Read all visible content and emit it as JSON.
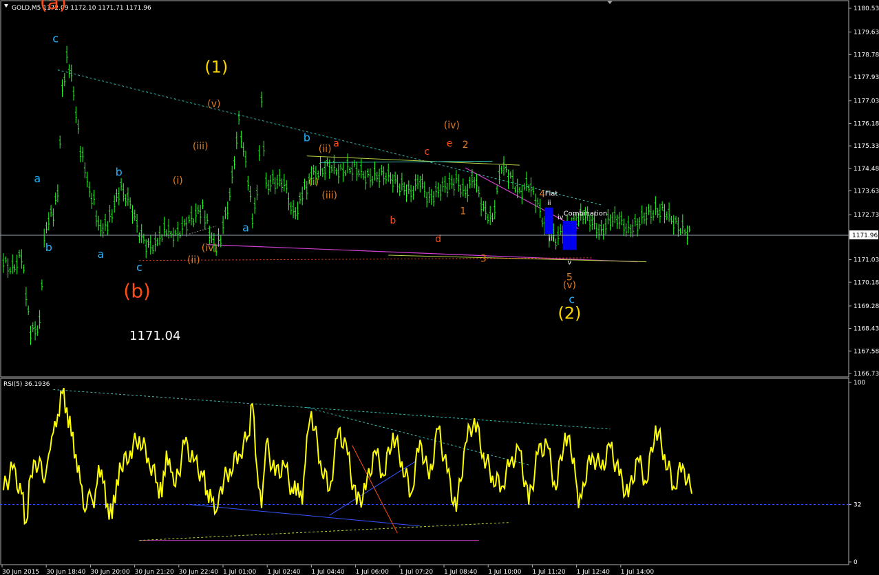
{
  "window": {
    "main_header": "GOLD,M5  1172.09 1172.10 1171.71 1171.96",
    "rsi_header": "RSI(5) 36.1936",
    "current_price_label": "1171.96",
    "big_price_text": "1171.04"
  },
  "colors": {
    "background": "#000000",
    "bull_candle": "#22ff22",
    "rsi_line": "#ffff00",
    "wave_blue": "#1fb2ff",
    "wave_orange": "#e07b20",
    "wave_red": "#ff4d1a",
    "wave_yellow": "#ffd700",
    "trend_magenta": "#d040d0",
    "trend_cyan_dashed": "#33c0b0",
    "trend_lime": "#b8d040",
    "correction_box": "#0000ee"
  },
  "chart_data": [
    {
      "type": "line",
      "title": "GOLD,M5",
      "ylabel": "",
      "xlabel": "",
      "ylim": [
        1166.73,
        1180.53
      ],
      "y_ticks": [
        "1180.53",
        "1179.63",
        "1178.78",
        "1177.93",
        "1177.03",
        "1176.18",
        "1175.33",
        "1174.48",
        "1173.63",
        "1172.73",
        "1171.96",
        "1171.03",
        "1170.18",
        "1169.28",
        "1168.43",
        "1167.58",
        "1166.73"
      ],
      "x_ticks": [
        "30 Jun 2015",
        "30 Jun 18:40",
        "30 Jun 20:00",
        "30 Jun 21:20",
        "30 Jun 22:40",
        "1 Jul 01:00",
        "1 Jul 02:40",
        "1 Jul 04:40",
        "1 Jul 06:00",
        "1 Jul 07:20",
        "1 Jul 08:40",
        "1 Jul 10:00",
        "1 Jul 11:20",
        "1 Jul 12:40",
        "1 Jul 14:00"
      ],
      "x_range": [
        0,
        152
      ],
      "series": [
        {
          "x": [
            0,
            2,
            4,
            5,
            6,
            8,
            9,
            10,
            11,
            12,
            13,
            14,
            15,
            16,
            17,
            18,
            19,
            20,
            21,
            22,
            23,
            24,
            25,
            26,
            28,
            30,
            32,
            34,
            35,
            36,
            37,
            38,
            40,
            42,
            44,
            45,
            46,
            47,
            48,
            50,
            52,
            54,
            55,
            56,
            57,
            58,
            60,
            62,
            64,
            65,
            66,
            67,
            68,
            70,
            72,
            74,
            76,
            78,
            80,
            82,
            84,
            86,
            88,
            90,
            92,
            94,
            96,
            98,
            100,
            102,
            104,
            106,
            108,
            110,
            112,
            114,
            116,
            118,
            120,
            122,
            124,
            126,
            127,
            128,
            130,
            132,
            134,
            136,
            138,
            140,
            142,
            144,
            146,
            148,
            150,
            152
          ],
          "y": [
            1170.9,
            1170.7,
            1171.2,
            1169.8,
            1168.2,
            1168.6,
            1171.8,
            1172.6,
            1172.8,
            1173.6,
            1177.4,
            1178.6,
            1178.0,
            1176.6,
            1175.2,
            1174.5,
            1173.6,
            1173.2,
            1172.3,
            1172.2,
            1172.4,
            1172.8,
            1173.4,
            1173.7,
            1173.2,
            1172.0,
            1171.5,
            1171.7,
            1172.0,
            1172.2,
            1172.0,
            1171.9,
            1172.4,
            1172.6,
            1173.0,
            1172.4,
            1171.8,
            1171.5,
            1171.9,
            1173.4,
            1176.3,
            1174.1,
            1172.6,
            1173.5,
            1176.9,
            1173.9,
            1174.0,
            1173.9,
            1172.8,
            1172.9,
            1173.6,
            1173.8,
            1174.2,
            1174.4,
            1174.6,
            1174.3,
            1174.5,
            1174.5,
            1174.1,
            1174.2,
            1174.3,
            1174.0,
            1173.8,
            1173.6,
            1174.0,
            1173.3,
            1173.7,
            1173.8,
            1174.0,
            1173.6,
            1174.1,
            1172.9,
            1172.6,
            1174.6,
            1174.1,
            1173.6,
            1173.9,
            1173.1,
            1172.1,
            1171.8,
            1172.2,
            1172.4,
            1172.6,
            1172.8,
            1172.4,
            1172.1,
            1172.6,
            1172.5,
            1172.2,
            1172.4,
            1172.7,
            1172.9,
            1172.9,
            1172.4,
            1172.2,
            1172.0
          ]
        }
      ]
    },
    {
      "type": "line",
      "title": "RSI(5) 36.1936",
      "ylabel": "",
      "xlabel": "",
      "ylim": [
        0,
        100
      ],
      "y_ticks": [
        "100",
        "32",
        "0"
      ],
      "series": [
        {
          "x": [
            0,
            2,
            4,
            5,
            6,
            8,
            9,
            10,
            11,
            12,
            13,
            14,
            15,
            16,
            17,
            18,
            19,
            20,
            21,
            22,
            23,
            24,
            25,
            26,
            28,
            30,
            32,
            34,
            35,
            36,
            37,
            38,
            40,
            42,
            44,
            45,
            46,
            47,
            48,
            50,
            52,
            54,
            55,
            56,
            57,
            58,
            60,
            62,
            64,
            65,
            66,
            67,
            68,
            70,
            72,
            74,
            76,
            78,
            80,
            82,
            84,
            86,
            88,
            90,
            92,
            94,
            96,
            98,
            100,
            102,
            104,
            106,
            108,
            110,
            112,
            114,
            116,
            118,
            120,
            122,
            124,
            126,
            127,
            128,
            130,
            132,
            134,
            136,
            138,
            140,
            142,
            144,
            146,
            148,
            150,
            152
          ],
          "y": [
            40,
            52,
            38,
            22,
            48,
            58,
            44,
            60,
            72,
            82,
            94,
            86,
            70,
            60,
            44,
            28,
            40,
            30,
            54,
            44,
            32,
            24,
            46,
            52,
            62,
            70,
            58,
            44,
            36,
            62,
            50,
            42,
            66,
            56,
            48,
            40,
            34,
            28,
            42,
            52,
            60,
            70,
            88,
            52,
            30,
            66,
            48,
            54,
            38,
            44,
            32,
            70,
            84,
            56,
            40,
            74,
            60,
            32,
            40,
            62,
            48,
            72,
            56,
            38,
            68,
            46,
            74,
            50,
            28,
            66,
            80,
            60,
            48,
            42,
            56,
            62,
            32,
            60,
            66,
            40,
            72,
            58,
            30,
            44,
            60,
            52,
            64,
            48,
            36,
            58,
            44,
            76,
            60,
            42,
            54,
            38
          ]
        }
      ],
      "reference_line": 32
    }
  ],
  "annotations": {
    "blue": [
      {
        "text": "c",
        "x": 11.5,
        "y": 1179.25
      },
      {
        "text": "a",
        "x": 7.5,
        "y": 1173.95
      },
      {
        "text": "b",
        "x": 10,
        "y": 1171.35
      },
      {
        "text": "b",
        "x": 25.5,
        "y": 1174.2
      },
      {
        "text": "a",
        "x": 21.5,
        "y": 1171.1
      },
      {
        "text": "c",
        "x": 30,
        "y": 1170.6
      },
      {
        "text": "a",
        "x": 53.5,
        "y": 1172.1
      },
      {
        "text": "b",
        "x": 67,
        "y": 1175.5
      },
      {
        "text": "c",
        "x": 125.5,
        "y": 1169.4
      }
    ],
    "orange": [
      {
        "text": "(v)",
        "x": 46.5,
        "y": 1176.8
      },
      {
        "text": "(iii)",
        "x": 43.5,
        "y": 1175.2
      },
      {
        "text": "(i)",
        "x": 38.5,
        "y": 1173.9
      },
      {
        "text": "(ii)",
        "x": 42,
        "y": 1170.9
      },
      {
        "text": "(iv)",
        "x": 45.5,
        "y": 1171.35
      },
      {
        "text": "(ii)",
        "x": 71,
        "y": 1175.1
      },
      {
        "text": "(i)",
        "x": 68.5,
        "y": 1173.85
      },
      {
        "text": "(iii)",
        "x": 72,
        "y": 1173.35
      },
      {
        "text": "(iv)",
        "x": 99,
        "y": 1176.0
      },
      {
        "text": "2",
        "x": 102,
        "y": 1175.25
      },
      {
        "text": "1",
        "x": 101.5,
        "y": 1172.75
      },
      {
        "text": "3",
        "x": 106,
        "y": 1170.95
      },
      {
        "text": "4",
        "x": 119,
        "y": 1173.4
      },
      {
        "text": "5",
        "x": 125,
        "y": 1170.25
      },
      {
        "text": "(v)",
        "x": 125,
        "y": 1169.95
      },
      {
        "text": "(1)",
        "x": 47,
        "y": 1178.1
      },
      {
        "text": "(2)",
        "x": 125,
        "y": 1168.8
      }
    ],
    "red": [
      {
        "text": "(a)",
        "x": 11,
        "y": 1180.5
      },
      {
        "text": "(b)",
        "x": 29.5,
        "y": 1169.6
      },
      {
        "text": "a",
        "x": 73.5,
        "y": 1175.3
      },
      {
        "text": "c",
        "x": 93.5,
        "y": 1175.0
      },
      {
        "text": "e",
        "x": 98.5,
        "y": 1175.3
      },
      {
        "text": "b",
        "x": 86,
        "y": 1172.4
      },
      {
        "text": "d",
        "x": 96,
        "y": 1171.7
      }
    ],
    "white": [
      {
        "text": "Flat",
        "x": 121,
        "y": 1173.45
      },
      {
        "text": "Combination",
        "x": 128.5,
        "y": 1172.7
      },
      {
        "text": "ii",
        "x": 120.5,
        "y": 1173.1
      },
      {
        "text": "iv",
        "x": 123,
        "y": 1172.55
      },
      {
        "text": "iii",
        "x": 121,
        "y": 1171.75
      },
      {
        "text": "v",
        "x": 125,
        "y": 1170.85
      }
    ]
  }
}
